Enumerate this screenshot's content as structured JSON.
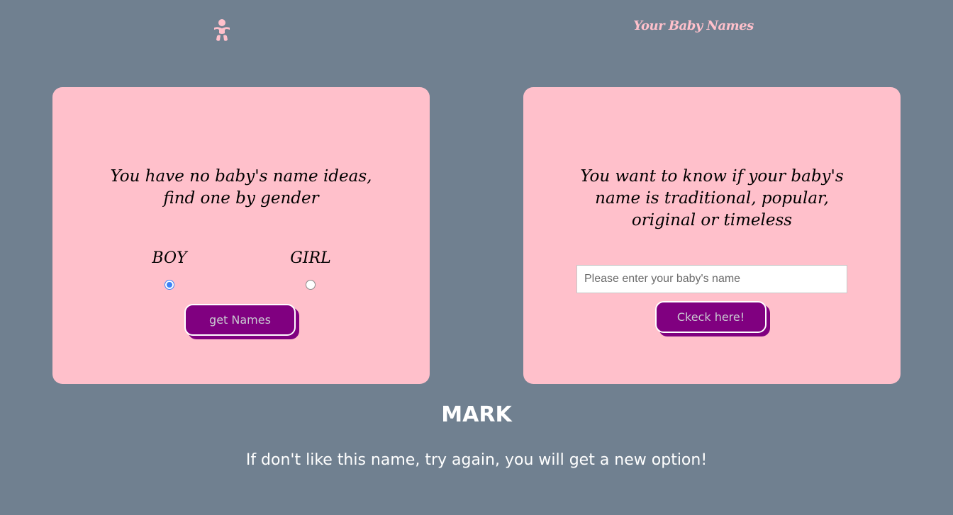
{
  "header": {
    "logo_icon": "baby-icon",
    "title": "Your Baby Names"
  },
  "colors": {
    "background": "#708090",
    "card": "#ffc0cb",
    "button": "#800080",
    "accent_pink": "#ffc0cb",
    "radio_selected": "#3b82f6"
  },
  "gender_card": {
    "heading": "You have no baby's name ideas, find one by gender",
    "options": [
      {
        "label": "BOY",
        "selected": true
      },
      {
        "label": "GIRL",
        "selected": false
      }
    ],
    "button_label": "get Names"
  },
  "check_card": {
    "heading": "You want to know if your baby's name is traditional, popular, original or timeless",
    "input_value": "",
    "input_placeholder": "Please enter your baby's name",
    "button_label": "Ckeck here!"
  },
  "result": {
    "name": "MARK",
    "hint": "If don't like this name, try again, you will get a new option!"
  }
}
